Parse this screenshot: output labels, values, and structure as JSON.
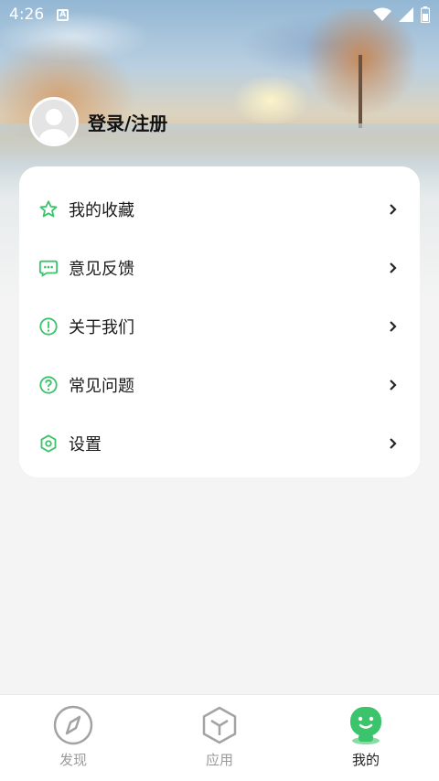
{
  "status_bar": {
    "time": "4:26",
    "notification_badge": "A"
  },
  "profile": {
    "login_label": "登录/注册"
  },
  "menu": {
    "items": [
      {
        "label": "我的收藏",
        "icon": "star-icon"
      },
      {
        "label": "意见反馈",
        "icon": "chat-icon"
      },
      {
        "label": "关于我们",
        "icon": "info-icon"
      },
      {
        "label": "常见问题",
        "icon": "question-icon"
      },
      {
        "label": "设置",
        "icon": "settings-icon"
      }
    ]
  },
  "tabbar": {
    "tabs": [
      {
        "label": "发现",
        "icon": "compass-icon",
        "active": false
      },
      {
        "label": "应用",
        "icon": "cube-icon",
        "active": false
      },
      {
        "label": "我的",
        "icon": "mascot-icon",
        "active": true
      }
    ]
  },
  "colors": {
    "accent": "#3cc46d",
    "text": "#1a1a1a",
    "inactive_tab": "#9a9a9a"
  }
}
